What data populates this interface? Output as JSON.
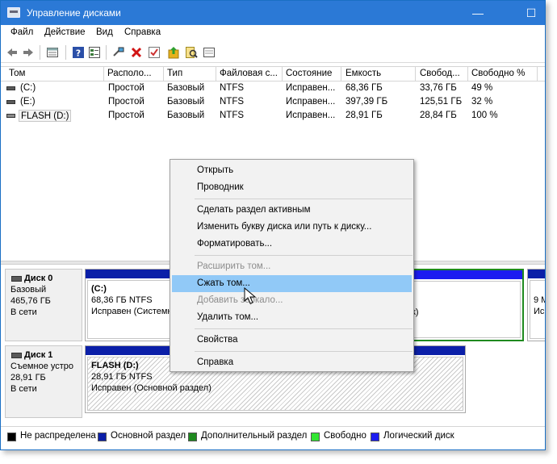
{
  "window": {
    "title": "Управление дисками"
  },
  "titlebar_buttons": {
    "minimize": "—",
    "maximize": "☐"
  },
  "menu": [
    "Файл",
    "Действие",
    "Вид",
    "Справка"
  ],
  "toolbar": {
    "icons": [
      "back-arrow-icon",
      "forward-arrow-icon",
      "disk-list-icon",
      "help-icon",
      "properties-icon",
      "connect-icon",
      "delete-icon",
      "check-icon",
      "export-icon",
      "search-icon",
      "view-icon"
    ],
    "colors": {
      "delete": "#d11414",
      "help": "#2b4fa8",
      "export": "#e7b11b"
    }
  },
  "table": {
    "columns": [
      "Том",
      "Располо...",
      "Тип",
      "Файловая с...",
      "Состояние",
      "Емкость",
      "Свобод...",
      "Свободно %"
    ],
    "rows": [
      {
        "vol": "(C:)",
        "layout": "Простой",
        "type": "Базовый",
        "fs": "NTFS",
        "status": "Исправен...",
        "capacity": "68,36 ГБ",
        "free": "33,76 ГБ",
        "free_pct": "49 %"
      },
      {
        "vol": "(E:)",
        "layout": "Простой",
        "type": "Базовый",
        "fs": "NTFS",
        "status": "Исправен...",
        "capacity": "397,39 ГБ",
        "free": "125,51 ГБ",
        "free_pct": "32 %"
      },
      {
        "vol": "FLASH (D:)",
        "layout": "Простой",
        "type": "Базовый",
        "fs": "NTFS",
        "status": "Исправен...",
        "capacity": "28,91 ГБ",
        "free": "28,84 ГБ",
        "free_pct": "100 %"
      }
    ]
  },
  "disks": [
    {
      "name": "Диск 0",
      "kind": "Базовый",
      "size": "465,76 ГБ",
      "state": "В сети",
      "partitions": [
        {
          "name": "(C:)",
          "size": "68,36 ГБ NTFS",
          "status": "Исправен (Системн"
        },
        {
          "tail_status": "к)"
        },
        {
          "size": "9 М",
          "status": "Исп"
        }
      ]
    },
    {
      "name": "Диск 1",
      "kind": "Съемное устро",
      "size": "28,91 ГБ",
      "state": "В сети",
      "partitions": [
        {
          "name": "FLASH  (D:)",
          "size": "28,91 ГБ NTFS",
          "status": "Исправен (Основной раздел)"
        }
      ]
    }
  ],
  "context_menu": {
    "items": [
      {
        "label": "Открыть",
        "state": "normal"
      },
      {
        "label": "Проводник",
        "state": "normal"
      },
      {
        "label": "Сделать раздел активным",
        "state": "normal"
      },
      {
        "label": "Изменить букву диска или путь к диску...",
        "state": "normal"
      },
      {
        "label": "Форматировать...",
        "state": "normal"
      },
      {
        "label": "Расширить том...",
        "state": "disabled"
      },
      {
        "label": "Сжать том...",
        "state": "highlight"
      },
      {
        "label": "Добавить зеркало...",
        "state": "disabled"
      },
      {
        "label": "Удалить том...",
        "state": "normal"
      },
      {
        "label": "Свойства",
        "state": "normal"
      },
      {
        "label": "Справка",
        "state": "normal"
      }
    ]
  },
  "legend": [
    {
      "label": "Не распределена",
      "color": "#000000"
    },
    {
      "label": "Основной раздел",
      "color": "#0b1fa8"
    },
    {
      "label": "Дополнительный раздел",
      "color": "#1f8a1f"
    },
    {
      "label": "Свободно",
      "color": "#33e633"
    },
    {
      "label": "Логический диск",
      "color": "#1c1cf0"
    }
  ]
}
